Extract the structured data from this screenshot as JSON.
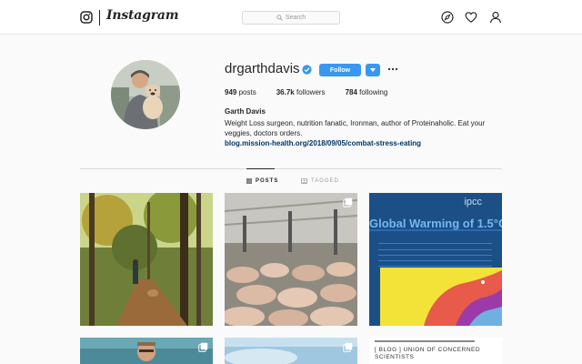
{
  "nav": {
    "wordmark": "Instagram",
    "search_placeholder": "Search",
    "icons": [
      "instagram-glyph-icon",
      "search-icon",
      "explore-compass-icon",
      "activity-heart-icon",
      "profile-person-icon"
    ]
  },
  "profile": {
    "username": "drgarthdavis",
    "follow_label": "Follow",
    "stats": {
      "posts_count": "949",
      "posts_label": "posts",
      "followers_count": "36.7k",
      "followers_label": "followers",
      "following_count": "784",
      "following_label": "following"
    },
    "full_name": "Garth Davis",
    "bio": "Weight Loss surgeon, nutrition fanatic, Ironman, author of Proteinaholic. Eat your veggies, doctors orders.",
    "link": "blog.mission-health.org/2018/09/05/combat-stress-eating"
  },
  "tabs": {
    "posts": "POSTS",
    "tagged": "TAGGED"
  },
  "posts": {
    "ipcc_logo": "ipcc",
    "ipcc_headline": "Global Warming of 1.5°C",
    "ucs_line1": "[ BLOG ] UNION OF CONCERNED",
    "ucs_line2": "SCIENTISTS"
  },
  "colors": {
    "follow_blue": "#3897f0",
    "link_navy": "#003569",
    "ipcc_blue": "#1b4f86"
  }
}
